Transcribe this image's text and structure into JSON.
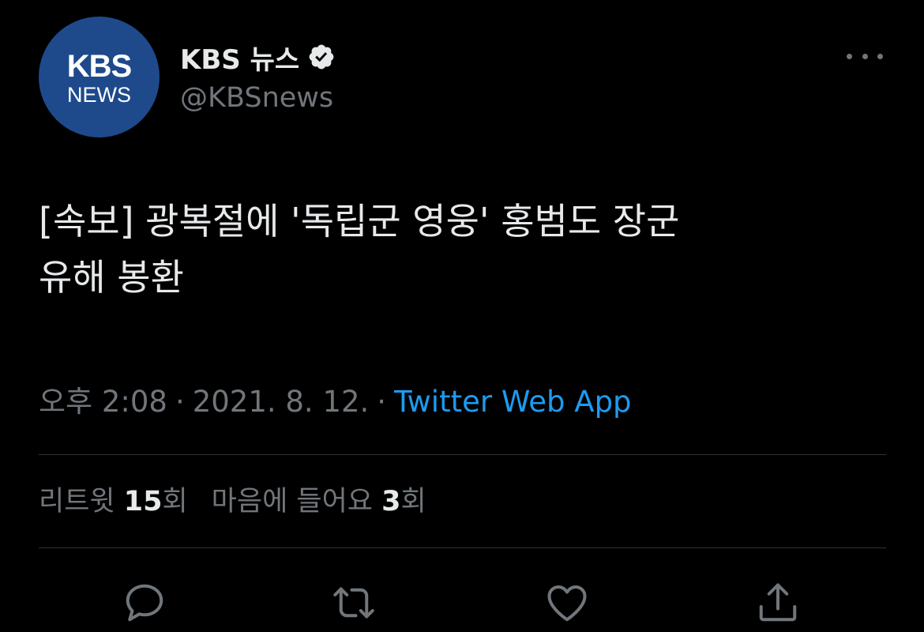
{
  "account": {
    "avatar_line1": "KBS",
    "avatar_line2": "NEWS",
    "display_name": "KBS 뉴스",
    "handle": "@KBSnews"
  },
  "tweet": {
    "line1": "[속보] 광복절에 '독립군 영웅' 홍범도 장군",
    "line2": "유해 봉환"
  },
  "meta": {
    "time": "오후 2:08",
    "separator": "·",
    "date": "2021. 8. 12.",
    "source": "Twitter Web App"
  },
  "stats": {
    "retweets_label": "리트윗",
    "retweets_count": "15",
    "retweets_unit": "회",
    "likes_label": "마음에 들어요",
    "likes_count": "3",
    "likes_unit": "회"
  },
  "icons": {
    "reply": "reply-icon",
    "retweet": "retweet-icon",
    "like": "heart-icon",
    "share": "share-icon",
    "verified": "verified-badge-icon",
    "more": "more-icon"
  },
  "colors": {
    "background": "#000000",
    "text": "#e7e9ea",
    "secondary": "#71767b",
    "link": "#1d9bf0",
    "avatar_bg": "#1e4a8c"
  }
}
